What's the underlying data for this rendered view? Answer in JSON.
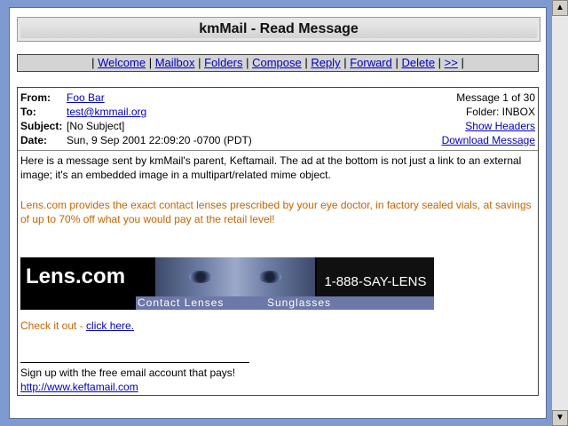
{
  "app": {
    "title": "kmMail - Read Message"
  },
  "nav": {
    "items": [
      "Welcome",
      "Mailbox",
      "Folders",
      "Compose",
      "Reply",
      "Forward",
      "Delete",
      ">>"
    ]
  },
  "headers": {
    "from_label": "From:",
    "from_value": "Foo Bar",
    "to_label": "To:",
    "to_value": "test@kmmail.org",
    "subject_label": "Subject:",
    "subject_value": "[No Subject]",
    "date_label": "Date:",
    "date_value": "Sun, 9 Sep 2001 22:09:20 -0700 (PDT)",
    "message_position": "Message 1 of 30",
    "folder": "Folder: INBOX",
    "show_headers": "Show Headers",
    "download_message": "Download Message"
  },
  "body": {
    "intro": "Here is a message sent by kmMail's parent, Keftamail. The ad at the bottom is not just a link to an external image; it's an embedded image in a multipart/related mime object.",
    "ad_text": "Lens.com provides the exact contact lenses prescribed by your eye doctor, in factory sealed vials, at savings of up to 70% off what you would pay at the retail level!",
    "banner": {
      "logo": "Lens.com",
      "phone": "1-888-SAY-LENS",
      "strip_left": "Contact Lenses",
      "strip_right": "Sunglasses"
    },
    "check_prefix": "Check it out - ",
    "check_link": "click here.",
    "signup": "Sign up with the free email account that pays!",
    "signup_link": "http://www.keftamail.com"
  },
  "colors": {
    "background": "#7f9ad0",
    "link": "#0000cc",
    "ad_text": "#c86400"
  }
}
